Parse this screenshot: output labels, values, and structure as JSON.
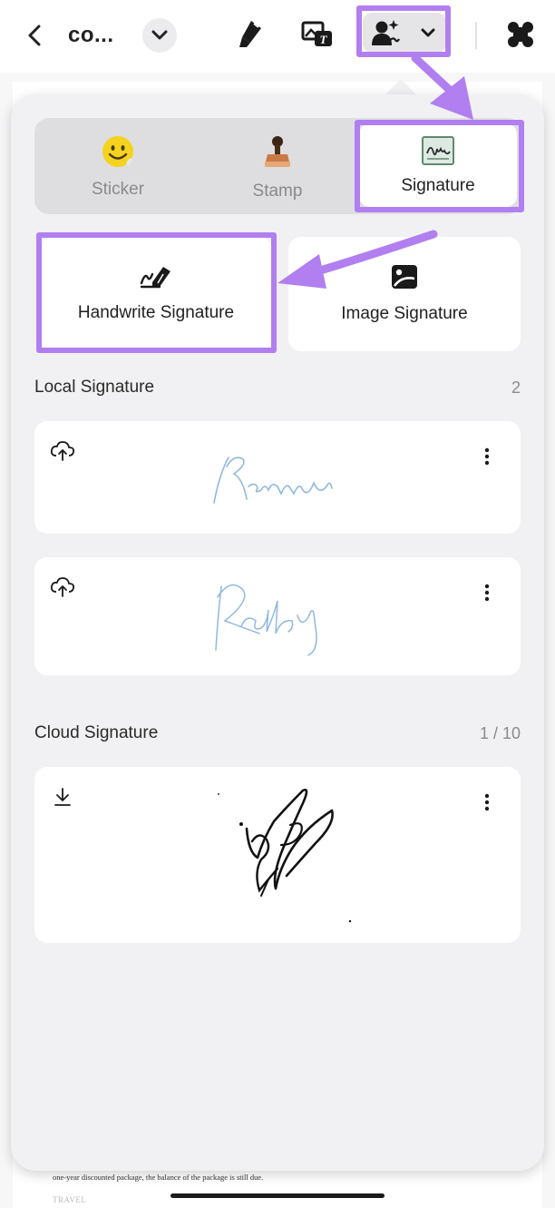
{
  "toolbar": {
    "title": "co...",
    "icons": [
      "back-icon",
      "chevron-down-icon",
      "highlighter-icon",
      "image-text-icon",
      "signature-user-icon",
      "chevron-down-icon",
      "apps-grid-icon"
    ]
  },
  "tabs": [
    {
      "label": "Sticker",
      "icon": "smiley-sticker-icon",
      "selected": false
    },
    {
      "label": "Stamp",
      "icon": "stamp-icon",
      "selected": false
    },
    {
      "label": "Signature",
      "icon": "signature-icon",
      "selected": true
    }
  ],
  "actions": {
    "handwrite_label": "Handwrite Signature",
    "image_label": "Image Signature"
  },
  "local": {
    "title": "Local Signature",
    "count": "2"
  },
  "cloud": {
    "title": "Cloud Signature",
    "count": "1 / 10"
  },
  "document": {
    "line1": "one-year discounted package, the balance of the package is still due.",
    "line2": "TRAVEL"
  },
  "colors": {
    "highlight": "#b17ff0",
    "panel_bg": "#f1f1f3",
    "segment_bg": "#dedee0",
    "local_signature_ink": "#8fb8e0",
    "cloud_signature_ink": "#111111"
  }
}
